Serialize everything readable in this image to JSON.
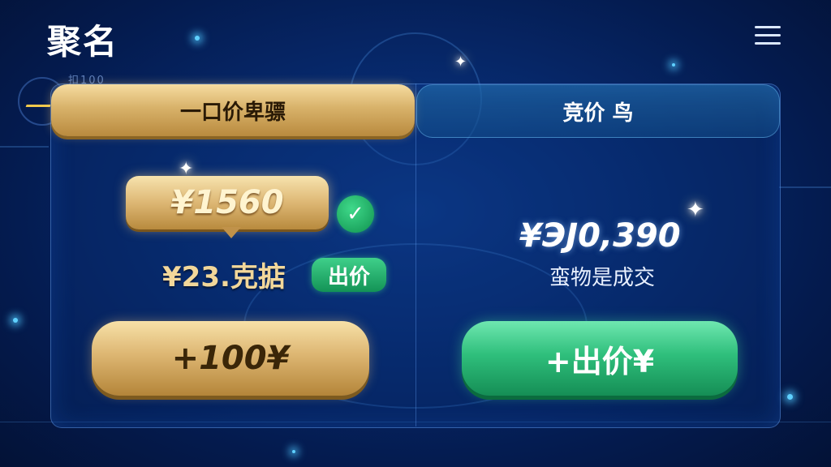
{
  "header": {
    "title": "聚名"
  },
  "tabs": {
    "left_label": "一口价卑骠",
    "right_label": "竞价 鸟"
  },
  "left": {
    "price_tag": "¥1560",
    "sub_price": "¥23.克掂",
    "bid_chip": "出价",
    "add_button": "+100¥"
  },
  "right": {
    "price": "¥ЭЈ0,390",
    "sub_text": "蛮物是成交",
    "bid_button": "+出价¥"
  },
  "decor": {
    "top_left_text": "扣100"
  },
  "colors": {
    "gold": "#d8b26a",
    "green": "#2fbf7c",
    "bg": "#072a6e"
  }
}
